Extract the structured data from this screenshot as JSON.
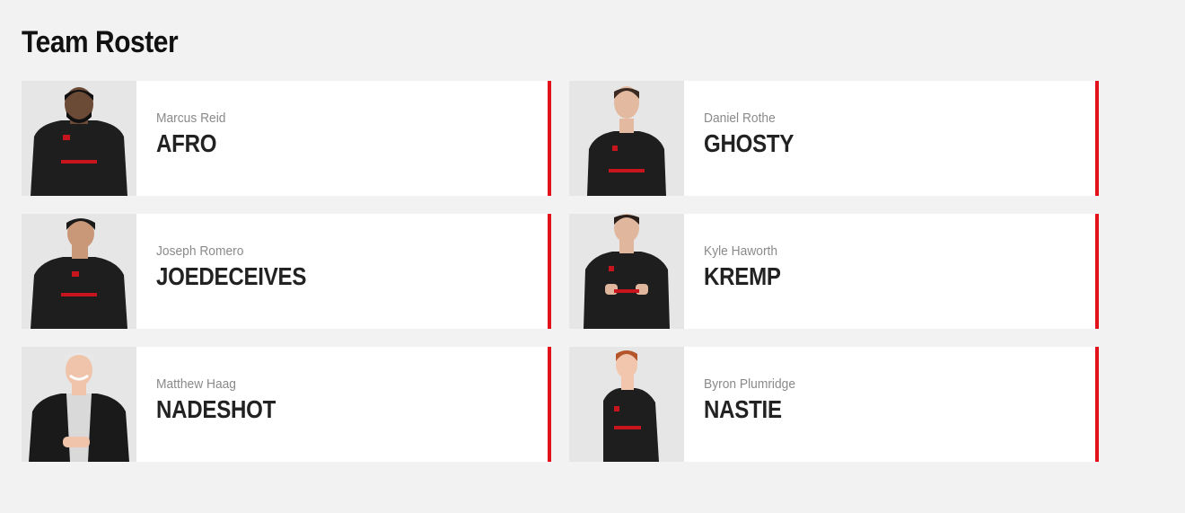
{
  "page": {
    "title": "Team Roster"
  },
  "colors": {
    "background": "#f2f2f2",
    "card": "#ffffff",
    "accent": "#e2121b",
    "jersey": "#1e1e1e",
    "photo_bg": "#e6e6e6"
  },
  "roster": [
    {
      "real_name": "Marcus Reid",
      "gamertag": "AFRO",
      "photo_icon": "player-photo"
    },
    {
      "real_name": "Daniel Rothe",
      "gamertag": "GHOSTY",
      "photo_icon": "player-photo"
    },
    {
      "real_name": "Joseph Romero",
      "gamertag": "JOEDECEIVES",
      "photo_icon": "player-photo"
    },
    {
      "real_name": "Kyle Haworth",
      "gamertag": "KREMP",
      "photo_icon": "player-photo"
    },
    {
      "real_name": "Matthew Haag",
      "gamertag": "NADESHOT",
      "photo_icon": "player-photo"
    },
    {
      "real_name": "Byron Plumridge",
      "gamertag": "NASTIE",
      "photo_icon": "player-photo"
    }
  ]
}
